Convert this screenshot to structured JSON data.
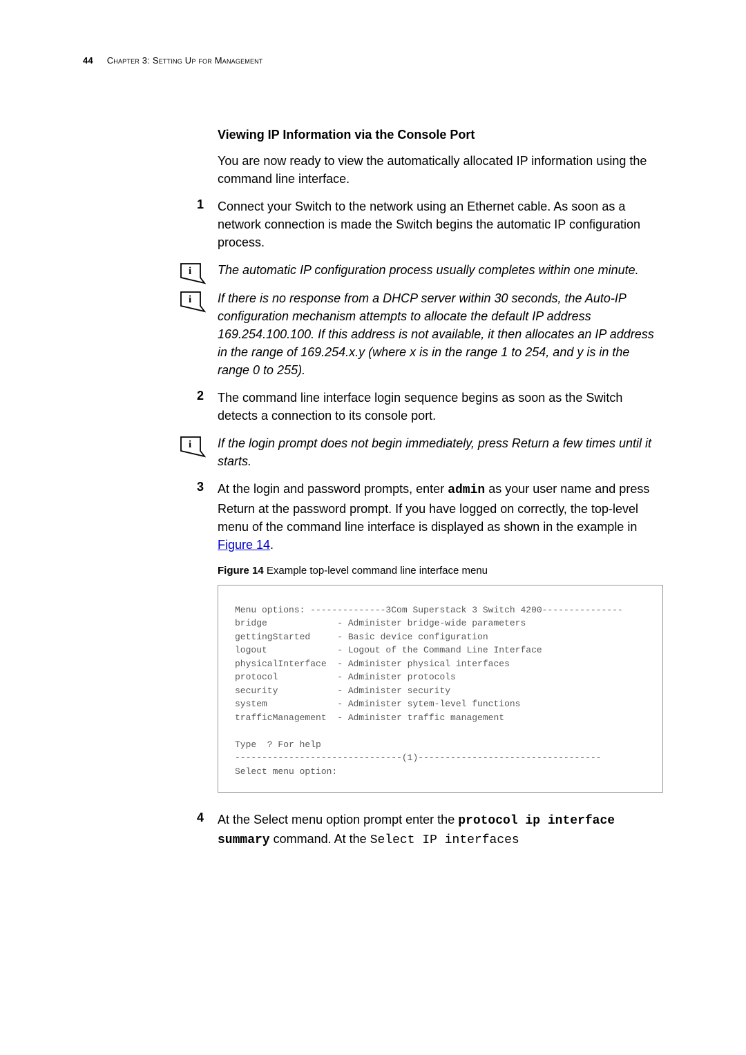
{
  "header": {
    "page_number": "44",
    "chapter": "Chapter 3: Setting Up for Management"
  },
  "section_heading": "Viewing IP Information via the Console Port",
  "intro_para": "You are now ready to view the automatically allocated IP information using the command line interface.",
  "step1": "Connect your Switch to the network using an Ethernet cable. As soon as a network connection is made the Switch begins the automatic IP configuration process.",
  "note1": "The automatic IP configuration process usually completes within one minute.",
  "note2": "If there is no response from a DHCP server within 30 seconds, the Auto-IP configuration mechanism attempts to allocate the default IP address 169.254.100.100. If this address is not available, it then allocates an IP address in the range of 169.254.x.y (where x is in the range 1 to 254, and y is in the range 0 to 255).",
  "step2": "The command line interface login sequence begins as soon as the Switch detects a connection to its console port.",
  "note3": "If the login prompt does not begin immediately, press Return a few times until it starts.",
  "step3_pre": "At the login and password prompts, enter ",
  "step3_admin": "admin",
  "step3_post": " as your user name and press Return at the password prompt. If you have logged on correctly, the top-level menu of the command line interface is displayed as shown in the example in ",
  "step3_link": "Figure 14",
  "step3_end": ".",
  "figure_label": "Figure 14",
  "figure_caption": "   Example top-level command line interface menu",
  "chart_data": {
    "type": "table",
    "title": "Example top-level command line interface menu",
    "header_line": "Menu options: --------------3Com Superstack 3 Switch 4200---------------",
    "rows": [
      {
        "option": "bridge",
        "description": "- Administer bridge-wide parameters"
      },
      {
        "option": "gettingStarted",
        "description": "- Basic device configuration"
      },
      {
        "option": "logout",
        "description": "- Logout of the Command Line Interface"
      },
      {
        "option": "physicalInterface",
        "description": "- Administer physical interfaces"
      },
      {
        "option": "protocol",
        "description": "- Administer protocols"
      },
      {
        "option": "security",
        "description": "- Administer security"
      },
      {
        "option": "system",
        "description": "- Administer sytem-level functions"
      },
      {
        "option": "trafficManagement",
        "description": "- Administer traffic management"
      }
    ],
    "help_line": "Type  ? For help",
    "divider_line": "-------------------------------(1)----------------------------------",
    "prompt_line": "Select menu option:"
  },
  "code_block": "Menu options: --------------3Com Superstack 3 Switch 4200---------------\nbridge             - Administer bridge-wide parameters\ngettingStarted     - Basic device configuration\nlogout             - Logout of the Command Line Interface\nphysicalInterface  - Administer physical interfaces\nprotocol           - Administer protocols\nsecurity           - Administer security\nsystem             - Administer sytem-level functions\ntrafficManagement  - Administer traffic management\n\nType  ? For help\n-------------------------------(1)----------------------------------\nSelect menu option:",
  "step4_pre": "At the Select menu option prompt enter the ",
  "step4_cmd": "protocol ip interface summary",
  "step4_mid": " command. At the ",
  "step4_mono": "Select IP interfaces"
}
